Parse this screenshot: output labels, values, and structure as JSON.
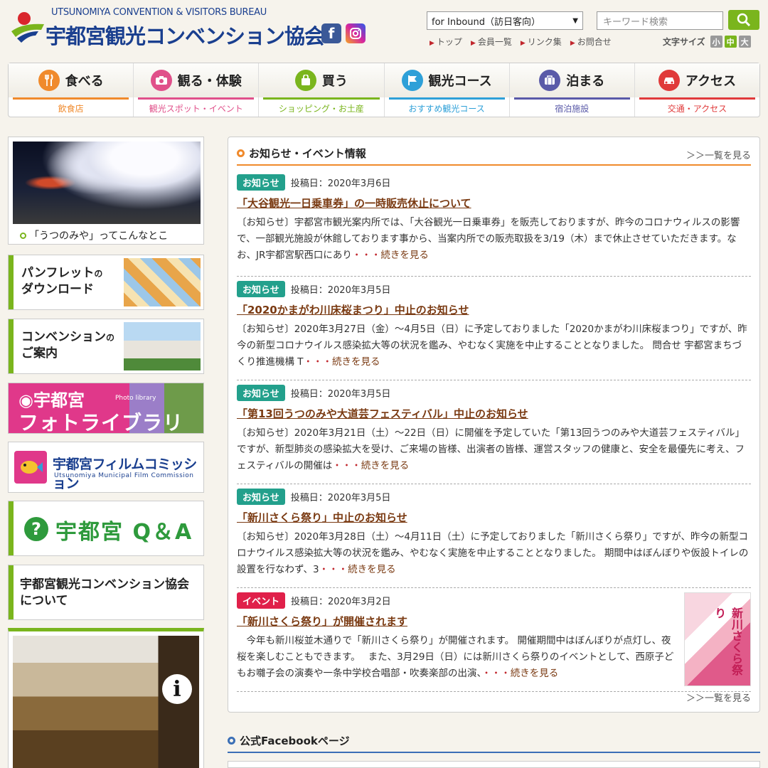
{
  "header": {
    "logo_en": "UTSUNOMIYA CONVENTION & VISITORS BUREAU",
    "logo_jp": "宇都宮観光コンベンション協会",
    "lang_select": "for Inbound（訪日客向）",
    "search_placeholder": "キーワード検索",
    "util_links": [
      "トップ",
      "会員一覧",
      "リンク集",
      "お問合せ"
    ],
    "font_size_label": "文字サイズ",
    "font_sizes": [
      "小",
      "中",
      "大"
    ]
  },
  "nav": [
    {
      "label": "食べる",
      "sub": "飲食店",
      "color": "#f08a2c",
      "icon": "fork-knife-icon"
    },
    {
      "label": "観る・体験",
      "sub": "観光スポット・イベント",
      "color": "#e0508a",
      "icon": "camera-icon"
    },
    {
      "label": "買う",
      "sub": "ショッピング・お土産",
      "color": "#7ab51d",
      "icon": "bag-icon"
    },
    {
      "label": "観光コース",
      "sub": "おすすめ観光コース",
      "color": "#2ea0d8",
      "icon": "flag-icon"
    },
    {
      "label": "泊まる",
      "sub": "宿泊施設",
      "color": "#5a5aa8",
      "icon": "suitcase-icon"
    },
    {
      "label": "アクセス",
      "sub": "交通・アクセス",
      "color": "#e03a3a",
      "icon": "car-icon"
    }
  ],
  "sidebar": {
    "intro_caption": "「うつのみや」ってこんなとこ",
    "pamphlet_line1": "パンフレット",
    "pamphlet_no": "の",
    "pamphlet_line2": "ダウンロード",
    "convention_line1": "コンベンション",
    "convention_no": "の",
    "convention_line2": "ご案内",
    "photo_line1": "宇都宮",
    "photo_en": "Photo library",
    "photo_line2": "フォトライブラリー",
    "film_jp": "宇都宮フィルムコミッション",
    "film_en": "Utsunomiya Municipal Film Commission",
    "qa_text": "宇都宮 Q＆A",
    "about_line1": "宇都宮観光コンベンション協会",
    "about_line2": "について"
  },
  "news": {
    "title": "お知らせ・イベント情報",
    "more": "＞＞一覧を見る",
    "continue": "続きを見る",
    "dots": "・・・",
    "items": [
      {
        "badge": "お知らせ",
        "date": "投稿日：2020年3月6日",
        "title": "「大谷観光一日乗車券」の一時販売休止について",
        "body": "〔お知らせ〕宇都宮市観光案内所では、「大谷観光一日乗車券」を販売しておりますが、昨今のコロナウィルスの影響で、一部観光施設が休館しております事から、当案内所での販売取扱を3/19（木）まで休止させていただきます。なお、JR宇都宮駅西口にあり"
      },
      {
        "badge": "お知らせ",
        "date": "投稿日：2020年3月5日",
        "title": "「2020かまがわ川床桜まつり」中止のお知らせ",
        "body": "〔お知らせ〕2020年3月27日（金）～4月5日（日）に予定しておりました「2020かまがわ川床桜まつり」ですが、昨今の新型コロナウイルス感染拡大等の状況を鑑み、やむなく実施を中止することとなりました。 問合せ 宇都宮まちづくり推進機構 T"
      },
      {
        "badge": "お知らせ",
        "date": "投稿日：2020年3月5日",
        "title": "「第13回うつのみや大道芸フェスティバル」中止のお知らせ",
        "body": "〔お知らせ〕2020年3月21日（土）～22日（日）に開催を予定していた「第13回うつのみや大道芸フェスティバル」ですが、新型肺炎の感染拡大を受け、ご来場の皆様、出演者の皆様、運営スタッフの健康と、安全を最優先に考え、フェスティバルの開催は"
      },
      {
        "badge": "お知らせ",
        "date": "投稿日：2020年3月5日",
        "title": "「新川さくら祭り」中止のお知らせ",
        "body": "〔お知らせ〕2020年3月28日（土）～4月11日（土）に予定しておりました「新川さくら祭り」ですが、昨今の新型コロナウイルス感染拡大等の状況を鑑み、やむなく実施を中止することとなりました。 期間中はぼんぼりや仮設トイレの設置を行なわず、3"
      },
      {
        "badge": "イベント",
        "date": "投稿日：2020年3月2日",
        "title": "「新川さくら祭り」が開催されます",
        "body": "　今年も新川桜並木通りで「新川さくら祭り」が開催されます。 開催期間中はぼんぼりが点灯し、夜桜を楽しむこともできます。　 また、3月29日（日）には新川さくら祭りのイベントとして、西原子どもお囃子会の演奏や一条中学校合唱部・吹奏楽部の出演、",
        "thumb_text": "新川さくら祭り"
      }
    ]
  },
  "facebook": {
    "title": "公式Facebookページ"
  }
}
